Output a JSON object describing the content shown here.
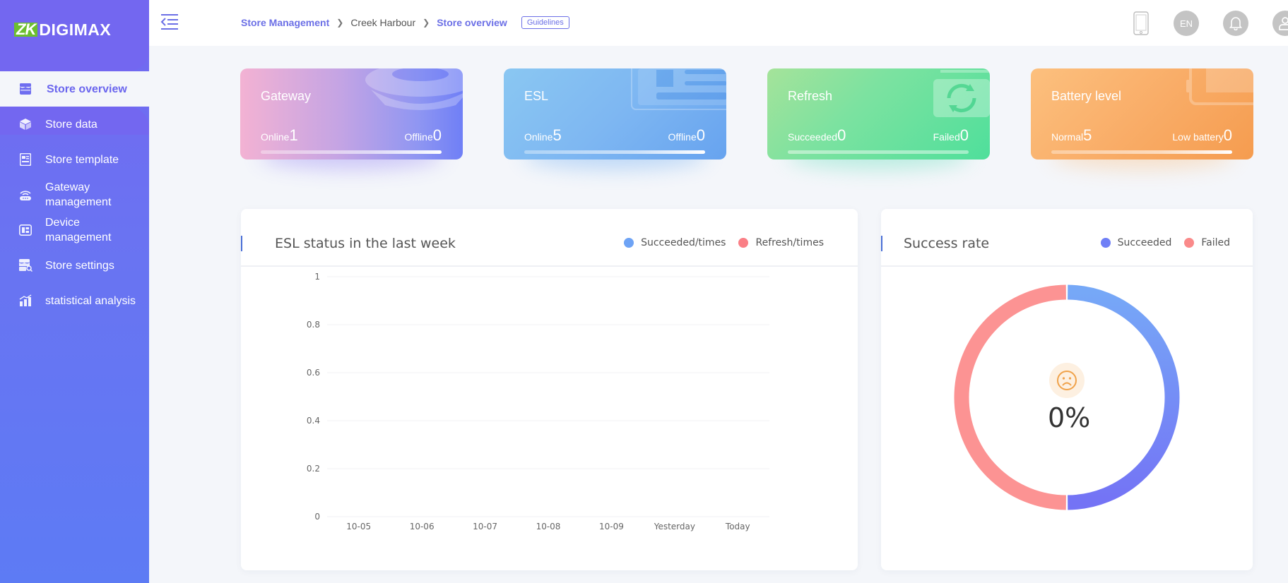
{
  "brand": {
    "logo_prefix": "ZK",
    "logo_suffix": "DIGIMAX",
    "accent": "#7367f0",
    "logo_green": "#6cbf2e"
  },
  "sidebar": {
    "active": {
      "label": "Store overview",
      "icon": "store-icon"
    },
    "items": [
      {
        "label": "Store data",
        "icon": "cube-icon"
      },
      {
        "label": "Store template",
        "icon": "template-icon"
      },
      {
        "label": "Gateway management",
        "icon": "router-icon"
      },
      {
        "label": "Device management",
        "icon": "device-icon"
      },
      {
        "label": "Store settings",
        "icon": "store-settings-icon"
      },
      {
        "label": "statistical analysis",
        "icon": "bar-chart-icon"
      }
    ]
  },
  "header": {
    "breadcrumb": [
      "Store Management",
      "Creek Harbour",
      "Store overview"
    ],
    "guidelines_label": "Guidelines",
    "language": "EN",
    "icons": [
      "mobile-icon",
      "language-icon",
      "bell-icon",
      "user-icon"
    ]
  },
  "cards": [
    {
      "title": "Gateway",
      "left_label": "Online",
      "left_value": "1",
      "right_label": "Offline",
      "right_value": "0",
      "colors": [
        "#f3b2d3",
        "#6f7ff6"
      ]
    },
    {
      "title": "ESL",
      "left_label": "Online",
      "left_value": "5",
      "right_label": "Offline",
      "right_value": "0",
      "colors": [
        "#8ac7f2",
        "#6aa8f0"
      ]
    },
    {
      "title": "Refresh",
      "left_label": "Succeeded",
      "left_value": "0",
      "right_label": "Failed",
      "right_value": "0",
      "colors": [
        "#a5e39a",
        "#4fdf9b"
      ]
    },
    {
      "title": "Battery level",
      "left_label": "Normal",
      "left_value": "5",
      "right_label": "Low battery",
      "right_value": "0",
      "colors": [
        "#fcc07e",
        "#f7a153"
      ]
    }
  ],
  "esl_panel": {
    "title": "ESL status in the last week",
    "legend": [
      {
        "label": "Succeeded/times",
        "color": "#6ea3f5"
      },
      {
        "label": "Refresh/times",
        "color": "#fa7f86"
      }
    ]
  },
  "rate_panel": {
    "title": "Success rate",
    "legend": [
      {
        "label": "Succeeded",
        "color": "#6f7ff6"
      },
      {
        "label": "Failed",
        "color": "#fa8a8a"
      }
    ],
    "value_text": "0%",
    "face_icon": "sad-face-icon"
  },
  "chart_data": [
    {
      "type": "line",
      "title": "ESL status in the last week",
      "categories": [
        "10-05",
        "10-06",
        "10-07",
        "10-08",
        "10-09",
        "Yesterday",
        "Today"
      ],
      "series": [
        {
          "name": "Succeeded/times",
          "values": [
            0,
            0,
            0,
            0,
            0,
            0,
            0
          ]
        },
        {
          "name": "Refresh/times",
          "values": [
            0,
            0,
            0,
            0,
            0,
            0,
            0
          ]
        }
      ],
      "yticks": [
        0,
        0.2,
        0.4,
        0.6,
        0.8,
        1
      ],
      "ylim": [
        0,
        1
      ],
      "xlabel": "",
      "ylabel": "",
      "grid": true,
      "legend": "top-right"
    },
    {
      "type": "pie",
      "title": "Success rate",
      "labels": [
        "Succeeded",
        "Failed"
      ],
      "values": [
        50,
        50
      ],
      "center_label": "0%",
      "legend": "top-right"
    }
  ]
}
